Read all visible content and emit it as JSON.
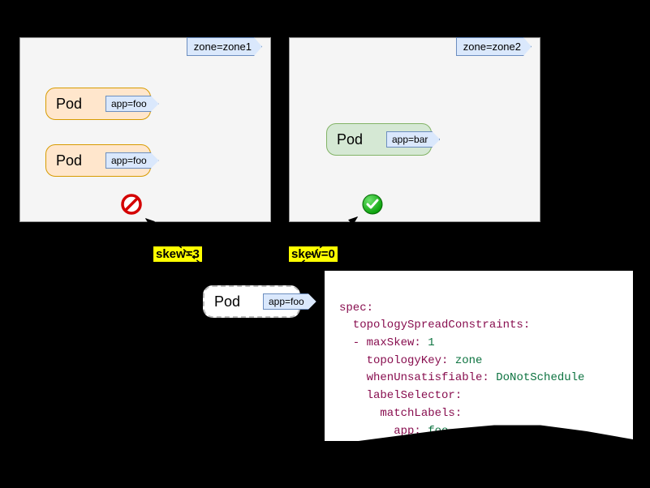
{
  "zones": {
    "zone1": {
      "label": "zone=zone1"
    },
    "zone2": {
      "label": "zone=zone2"
    }
  },
  "pods": {
    "podLabel": "Pod",
    "appFoo": "app=foo",
    "appBar": "app=bar"
  },
  "skew": {
    "left": "skew=3",
    "right": "skew=0"
  },
  "yaml": {
    "spec": "spec:",
    "tsc": "  topologySpreadConstraints:",
    "maxSkewKey": "  - maxSkew:",
    "maxSkewVal": " 1",
    "topologyKeyKey": "    topologyKey:",
    "topologyKeyVal": " zone",
    "whenKey": "    whenUnsatisfiable:",
    "whenVal": " DoNotSchedule",
    "labelSel": "    labelSelector:",
    "matchLabels": "      matchLabels:",
    "appKey": "        app:",
    "appVal": " foo"
  }
}
